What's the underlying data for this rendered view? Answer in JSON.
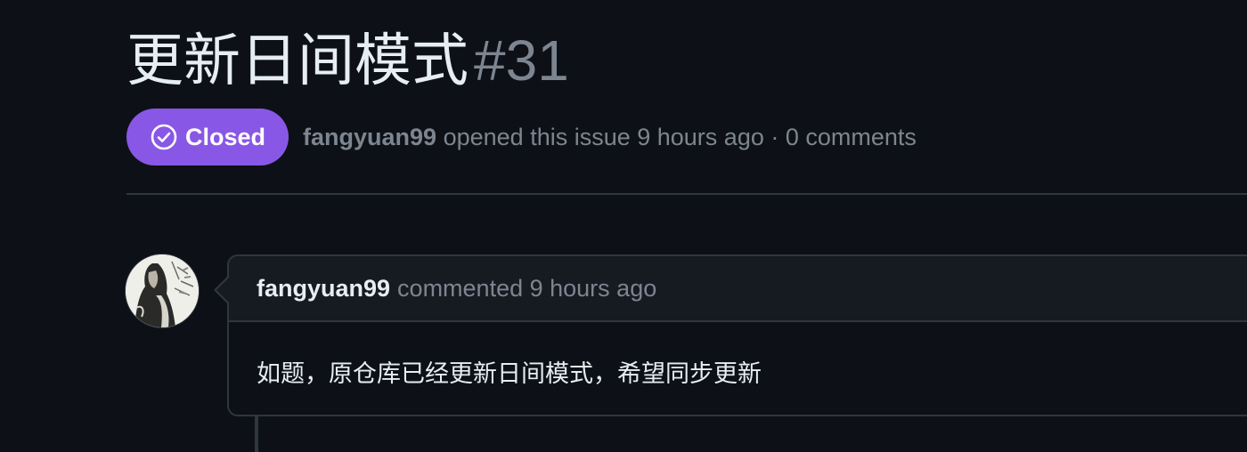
{
  "issue": {
    "title": "更新日间模式",
    "number": "#31",
    "state_label": "Closed",
    "state_color": "#8957e5",
    "author": "fangyuan99",
    "opened_text": "opened this issue 9 hours ago · 0 comments"
  },
  "comment": {
    "author": "fangyuan99",
    "meta": "commented 9 hours ago",
    "body": "如题，原仓库已经更新日间模式，希望同步更新",
    "avatar_icon": "user-avatar-icon"
  },
  "icons": {
    "state": "check-circle-icon"
  },
  "colors": {
    "background": "#0d1117",
    "muted": "#7d8590",
    "border": "#30363d",
    "header_bg": "#161b22"
  }
}
